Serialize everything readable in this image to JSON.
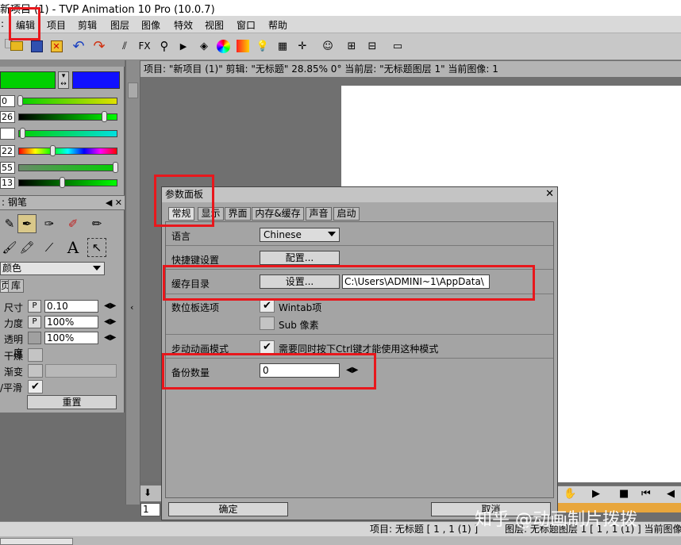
{
  "window": {
    "title": "新项目 (1) - TVP Animation 10 Pro (10.0.7)"
  },
  "menu": {
    "items": [
      "编辑",
      "项目",
      "剪辑",
      "图层",
      "图像",
      "特效",
      "视图",
      "窗口",
      "帮助"
    ]
  },
  "toolbar": {
    "fx_label": "FX"
  },
  "left_panel": {
    "colors": {
      "primary": "#00d000",
      "secondary": "#1010ff"
    },
    "slider_values": [
      "0",
      "26",
      "",
      "22",
      "55",
      "13"
    ],
    "brush_header": ": 钢笔",
    "text_tool": "A",
    "color_mode": "颜色",
    "sub_tabs": [
      "页",
      "库"
    ],
    "props": {
      "size_label": "尺寸",
      "size_value": "0.10",
      "power_label": "力度",
      "power_value": "100%",
      "opacity_label": "透明度",
      "opacity_value": "100%",
      "dry_label": "干燥",
      "gradient_label": "渐变",
      "smooth_label": "/平滑",
      "p_label": "P"
    },
    "reset_label": "重置"
  },
  "project_info": "项目: \"新项目 (1)\"  剪辑: \"无标题\"   28.85%   0°  当前层: \"无标题图层 1\"  当前图像: 1",
  "dialog": {
    "title": "参数面板",
    "tabs": [
      "常规",
      "显示",
      "界面",
      "内存&缓存",
      "声音",
      "启动"
    ],
    "language_label": "语言",
    "language_value": "Chinese",
    "shortcut_label": "快捷键设置",
    "shortcut_button": "配置...",
    "cache_label": "缓存目录",
    "cache_button": "设置...",
    "cache_path": "C:\\Users\\ADMINI~1\\AppData\\",
    "tablet_label": "数位板选项",
    "wintab_label": "Wintab项",
    "subpixel_label": "Sub 像素",
    "stepanim_label": "步动动画模式",
    "stepanim_option": "需要同时按下Ctrl键才能使用这种模式",
    "backup_label": "备份数量",
    "backup_value": "0",
    "ok_label": "确定",
    "cancel_label": "取消"
  },
  "frame_value": "1",
  "status": {
    "left": "项目: 无标题 [ 1 , 1  (1) ]",
    "right": "图层: 无标题图层 1 [ 1 , 1  (1) ]   当前图像"
  },
  "watermark": "知乎 @动画制片拨拨",
  "accent": "#e8171c"
}
